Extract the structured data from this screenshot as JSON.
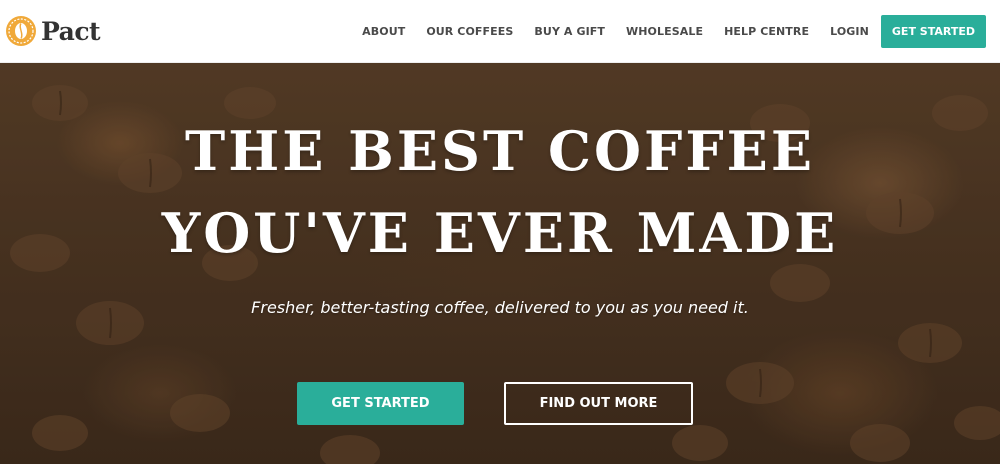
{
  "brand": {
    "name": "Pact",
    "logo_icon": "coffee-bean-badge-icon",
    "logo_color": "#f0a93a"
  },
  "nav": {
    "links": [
      {
        "label": "ABOUT"
      },
      {
        "label": "OUR COFFEES"
      },
      {
        "label": "BUY A GIFT"
      },
      {
        "label": "WHOLESALE"
      },
      {
        "label": "HELP CENTRE"
      },
      {
        "label": "LOGIN"
      }
    ],
    "cta_label": "GET STARTED"
  },
  "hero": {
    "headline_line1": "THE BEST COFFEE",
    "headline_line2": "YOU'VE EVER MADE",
    "subtitle": "Fresher, better-tasting coffee, delivered to you as you need it.",
    "primary_button": "GET STARTED",
    "secondary_button": "FIND OUT MORE",
    "background": "coffee-beans-photo"
  },
  "colors": {
    "accent": "#2aae9a",
    "nav_text": "#4a4a4a",
    "hero_dark": "#4d3623"
  }
}
